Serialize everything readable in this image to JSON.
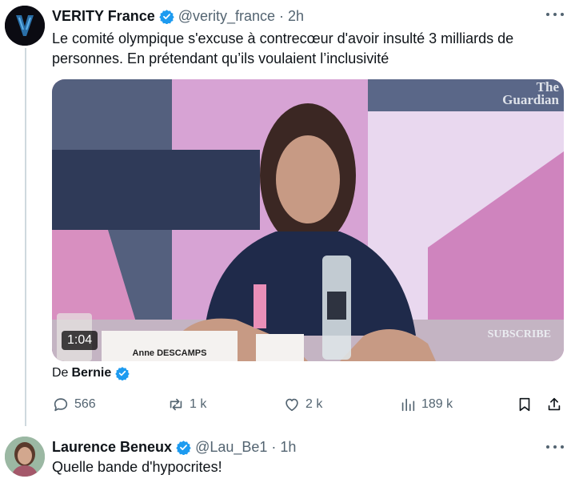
{
  "tweet": {
    "author_name": "VERITY France",
    "handle": "@verity_france",
    "separator": "·",
    "time": "2h",
    "text_line1": "Le comité olympique s'excuse à contrecœur d'avoir insulté 3 milliards de",
    "text_line2": "personnes. En prétendant qu’ils voulaient l’inclusivité",
    "media": {
      "watermark_line1": "The",
      "watermark_line2": "Guardian",
      "duration": "1:04",
      "subscribe": "SUBSCRIBE",
      "nameplate": "Anne DESCAMPS"
    },
    "attribution_prefix": "De",
    "attribution_name": "Bernie",
    "stats": {
      "replies": "566",
      "reposts": "1 k",
      "likes": "2 k",
      "views": "189 k"
    }
  },
  "reply": {
    "author_name": "Laurence Beneux",
    "handle": "@Lau_Be1",
    "separator": "·",
    "time": "1h",
    "text": "Quelle bande d'hypocrites!"
  },
  "colors": {
    "verified_blue": "#1d9bf0",
    "secondary_text": "#536471",
    "thread_line": "#cfd9de"
  },
  "icons": [
    "more-icon",
    "verified-badge-icon",
    "reply-icon",
    "repost-icon",
    "like-icon",
    "views-icon",
    "bookmark-icon",
    "share-icon"
  ]
}
